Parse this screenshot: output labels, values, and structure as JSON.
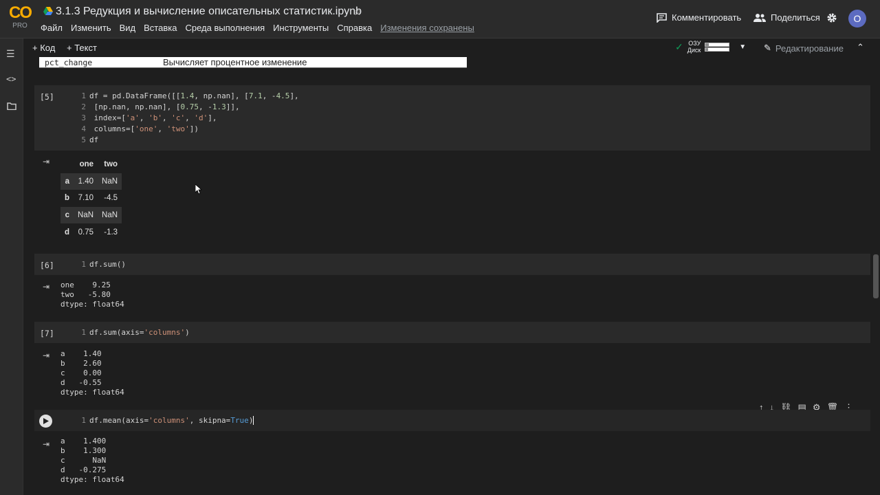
{
  "header": {
    "logo_text": "CO",
    "logo_badge": "PRO",
    "title": "3.1.3 Редукция и вычисление описательных статистик.ipynb",
    "menu": [
      "Файл",
      "Изменить",
      "Вид",
      "Вставка",
      "Среда выполнения",
      "Инструменты",
      "Справка"
    ],
    "save_status": "Изменения сохранены",
    "comment_label": "Комментировать",
    "share_label": "Поделиться",
    "avatar_letter": "O"
  },
  "toolbar": {
    "add_code": "+ Код",
    "add_text": "+ Текст",
    "ram_label": "ОЗУ",
    "disk_label": "Диск",
    "ram_fraction": 0.15,
    "disk_fraction": 0.1,
    "edit_mode": "Редактирование"
  },
  "ref_table_row": {
    "method": "pct_change",
    "description": "Вычисляет процентное изменение"
  },
  "cells": [
    {
      "num": "[5]",
      "lines": [
        "df = pd.DataFrame([[1.4, np.nan], [7.1, -4.5],",
        "                   [np.nan, np.nan], [0.75, -1.3]],",
        "                  index=['a', 'b', 'c', 'd'],",
        "                  columns=['one', 'two'])",
        "df"
      ]
    },
    {
      "num": "[6]",
      "lines": [
        "df.sum()"
      ],
      "output": "one    9.25\ntwo   -5.80\ndtype: float64"
    },
    {
      "num": "[7]",
      "lines": [
        "df.sum(axis='columns')"
      ],
      "output": "a    1.40\nb    2.60\nc    0.00\nd   -0.55\ndtype: float64"
    },
    {
      "num": "",
      "lines": [
        "df.mean(axis='columns', skipna=True)"
      ],
      "output": "a    1.400\nb    1.300\nc      NaN\nd   -0.275\ndtype: float64"
    }
  ],
  "df_output": {
    "columns": [
      "one",
      "two"
    ],
    "rows": [
      {
        "index": "a",
        "one": "1.40",
        "two": "NaN"
      },
      {
        "index": "b",
        "one": "7.10",
        "two": "-4.5"
      },
      {
        "index": "c",
        "one": "NaN",
        "two": "NaN"
      },
      {
        "index": "d",
        "one": "0.75",
        "two": "-1.3"
      }
    ]
  },
  "colors": {
    "accent": "#f9ab00",
    "avatar": "#5c6bc0",
    "string": "#ce9178",
    "number": "#b5cea8",
    "keyword": "#569cd6"
  }
}
